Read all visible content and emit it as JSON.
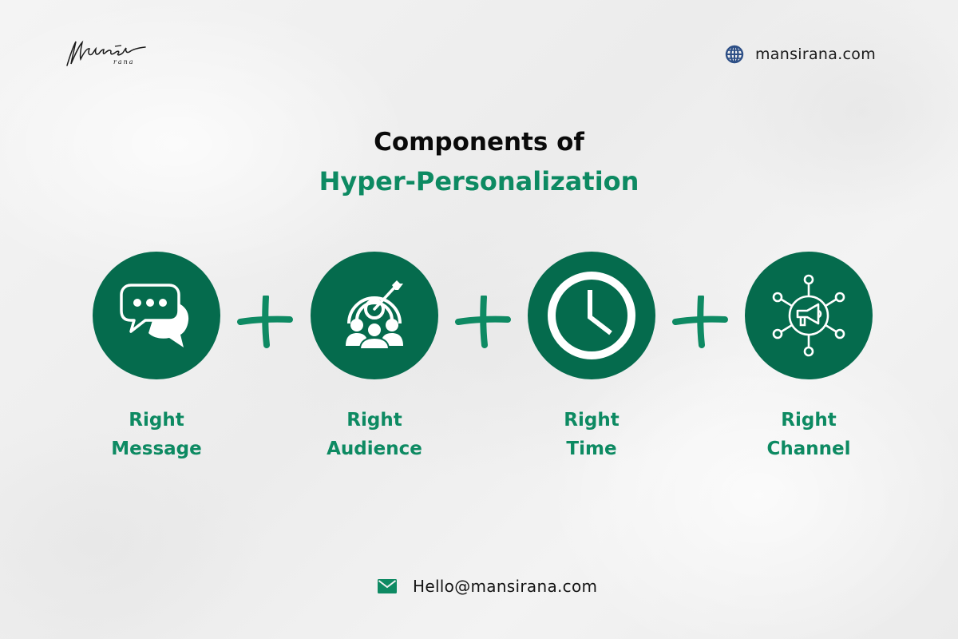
{
  "brand": {
    "logo_text": "Mansi",
    "logo_subtext": "rana",
    "logo_icon": "signature-logo"
  },
  "header": {
    "website_icon": "globe-icon",
    "website": "mansirana.com"
  },
  "title": {
    "line1": "Components of",
    "line2": "Hyper-Personalization"
  },
  "components": [
    {
      "icon": "chat-bubbles-icon",
      "label_line1": "Right",
      "label_line2": "Message"
    },
    {
      "icon": "target-audience-icon",
      "label_line1": "Right",
      "label_line2": "Audience"
    },
    {
      "icon": "clock-icon",
      "label_line1": "Right",
      "label_line2": "Time"
    },
    {
      "icon": "megaphone-network-icon",
      "label_line1": "Right",
      "label_line2": "Channel"
    }
  ],
  "separator_icon": "plus-icon",
  "footer": {
    "email_icon": "mail-icon",
    "email": "Hello@mansirana.com"
  },
  "colors": {
    "circle_fill": "#056b4d",
    "accent_green": "#0d8a62",
    "globe_blue": "#2d4f86",
    "text_dark": "#0a0a0a"
  }
}
